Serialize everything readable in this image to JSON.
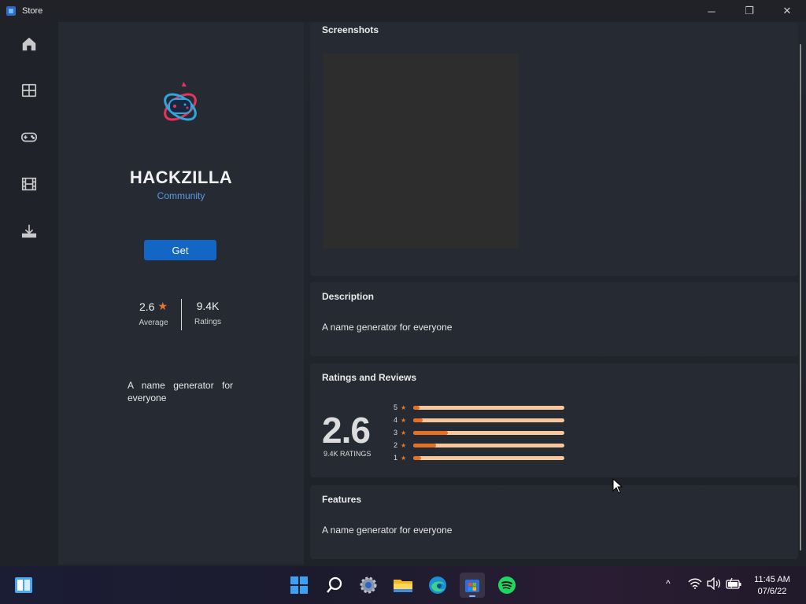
{
  "window": {
    "title": "Store",
    "controls": {
      "minimize": "─",
      "maximize": "❐",
      "close": "✕"
    }
  },
  "sidebar": {
    "items": [
      {
        "name": "home",
        "icon": "home-icon"
      },
      {
        "name": "apps",
        "icon": "apps-grid-icon"
      },
      {
        "name": "gaming",
        "icon": "gamepad-icon"
      },
      {
        "name": "movies",
        "icon": "film-icon"
      },
      {
        "name": "library",
        "icon": "download-icon"
      }
    ]
  },
  "app": {
    "name": "HACKZILLA",
    "publisher": "Community",
    "get_label": "Get",
    "average": "2.6",
    "average_label": "Average",
    "ratings_count": "9.4K",
    "ratings_label": "Ratings",
    "short_description": "A name generator for everyone"
  },
  "sections": {
    "screenshots_title": "Screenshots",
    "description_title": "Description",
    "description_text": "A name generator for everyone",
    "ratings_title": "Ratings and Reviews",
    "ratings_big": "2.6",
    "ratings_count_label": "9.4K RATINGS",
    "features_title": "Features",
    "features_text": "A name generator for everyone"
  },
  "rating_bars": [
    {
      "stars": "5",
      "fraction": 0.04
    },
    {
      "stars": "4",
      "fraction": 0.06
    },
    {
      "stars": "3",
      "fraction": 0.23
    },
    {
      "stars": "2",
      "fraction": 0.15
    },
    {
      "stars": "1",
      "fraction": 0.05
    }
  ],
  "colors": {
    "accent": "#1466c4",
    "star": "#e8772e",
    "bar_fill": "#e66f22",
    "bar_track": "#f6c89a",
    "publisher_link": "#5b9ce6"
  },
  "taskbar": {
    "icons": [
      "widgets-icon",
      "start-icon",
      "search-icon",
      "settings-icon",
      "file-explorer-icon",
      "edge-icon",
      "store-icon",
      "spotify-icon"
    ],
    "tray_chevron": "^",
    "time": "11:45 AM",
    "date": "07/6/22"
  }
}
